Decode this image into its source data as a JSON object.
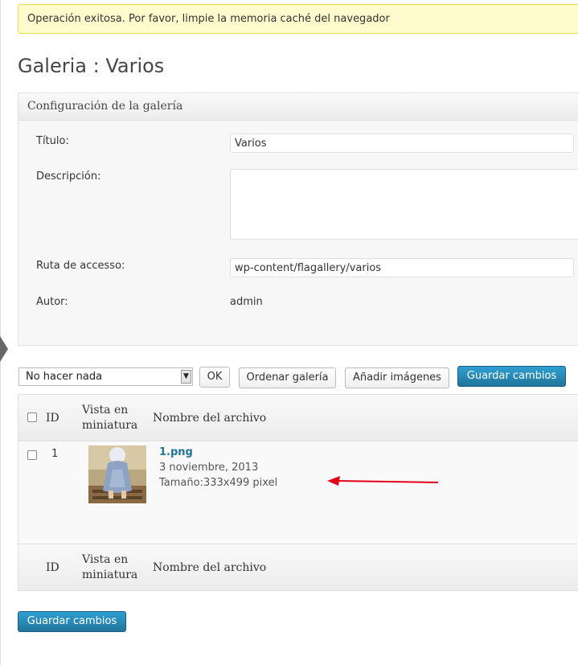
{
  "notice": {
    "message": "Operación exitosa. Por favor, limpie la memoria caché del navegador"
  },
  "page": {
    "title": "Galeria : Varios"
  },
  "settings": {
    "heading": "Configuración de la galería",
    "title_label": "Título:",
    "title_value": "Varios",
    "description_label": "Descripción:",
    "description_value": "",
    "path_label": "Ruta de accesso:",
    "path_value": "wp-content/flagallery/varios",
    "author_label": "Autor:",
    "author_value": "admin"
  },
  "actions": {
    "bulk_selected": "No hacer nada",
    "ok_label": "OK",
    "sort_label": "Ordenar galería",
    "add_label": "Añadir imágenes",
    "save_label": "Guardar cambios"
  },
  "table": {
    "col_id": "ID",
    "col_thumb_line1": "Vista en",
    "col_thumb_line2": "miniatura",
    "col_name": "Nombre del archivo",
    "rows": [
      {
        "id": "1",
        "filename": "1.png",
        "date": "3 noviembre, 2013",
        "size": "Tamaño:333x499 pixel"
      }
    ]
  },
  "footer": {
    "save_label": "Guardar cambios"
  },
  "colors": {
    "accent": "#21759b",
    "notice_bg": "#fffbcc",
    "arrow": "#e0001a"
  }
}
